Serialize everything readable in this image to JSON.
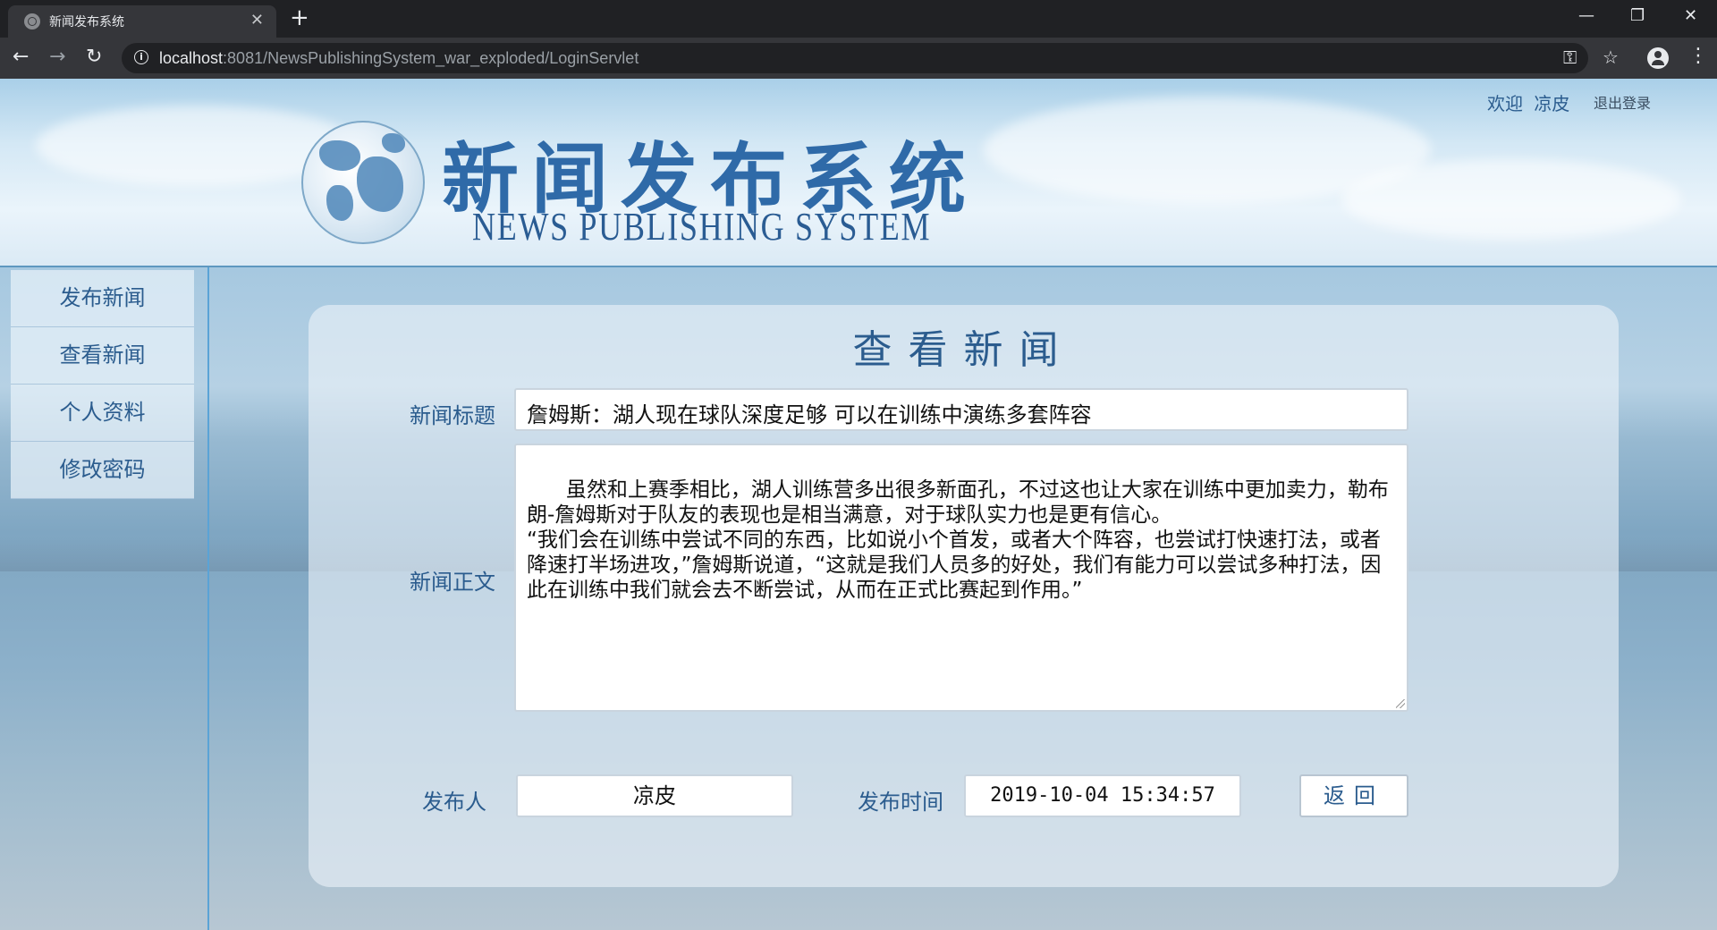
{
  "browser": {
    "tab_title": "新闻发布系统",
    "tab_close": "✕",
    "new_tab": "+",
    "url_host": "localhost",
    "url_rest": ":8081/NewsPublishingSystem_war_exploded/LoginServlet",
    "icons": [
      "back-icon",
      "forward-icon",
      "reload-icon",
      "info-icon",
      "key-icon",
      "star-icon",
      "profile-icon",
      "menu-icon",
      "minimize-icon",
      "restore-icon",
      "close-icon"
    ]
  },
  "header": {
    "logo_cn": "新闻发布系统",
    "logo_en": "NEWS PUBLISHING SYSTEM",
    "welcome_label": "欢迎",
    "username": "凉皮",
    "logout": "退出登录"
  },
  "sidebar": {
    "items": [
      {
        "label": "发布新闻"
      },
      {
        "label": "查看新闻"
      },
      {
        "label": "个人资料"
      },
      {
        "label": "修改密码"
      }
    ]
  },
  "main": {
    "title": "查看新闻",
    "title_label": "新闻标题",
    "title_value": "詹姆斯：湖人现在球队深度足够 可以在训练中演练多套阵容",
    "body_label": "新闻正文",
    "body_value": "虽然和上赛季相比，湖人训练营多出很多新面孔，不过这也让大家在训练中更加卖力，勒布朗-詹姆斯对于队友的表现也是相当满意，对于球队实力也是更有信心。\n“我们会在训练中尝试不同的东西，比如说小个首发，或者大个阵容，也尝试打快速打法，或者降速打半场进攻，”詹姆斯说道，“这就是我们人员多的好处，我们有能力可以尝试多种打法，因此在训练中我们就会去不断尝试，从而在正式比赛起到作用。”",
    "publisher_label": "发布人",
    "publisher_value": "凉皮",
    "time_label": "发布时间",
    "time_value": "2019-10-04 15:34:57",
    "back_button": "返回"
  }
}
